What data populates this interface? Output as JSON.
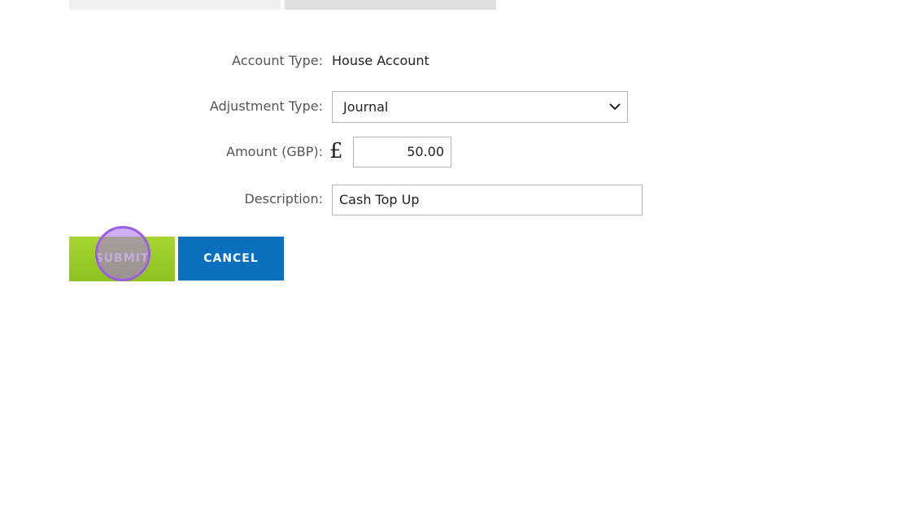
{
  "form": {
    "account_type": {
      "label": "Account Type:",
      "value": "House Account"
    },
    "adjustment_type": {
      "label": "Adjustment Type:",
      "selected": "Journal"
    },
    "amount": {
      "label": "Amount (GBP):",
      "currency_symbol": "£",
      "value": "50.00"
    },
    "description": {
      "label": "Description:",
      "value": "Cash Top Up"
    }
  },
  "actions": {
    "submit_label": "SUBMIT",
    "cancel_label": "CANCEL"
  },
  "colors": {
    "submit_bg": "#8cc21f",
    "cancel_bg": "#0a6fbd",
    "click_marker": "#9d5ce6"
  },
  "icons": {
    "select_chevron": "chevron-down-icon"
  }
}
